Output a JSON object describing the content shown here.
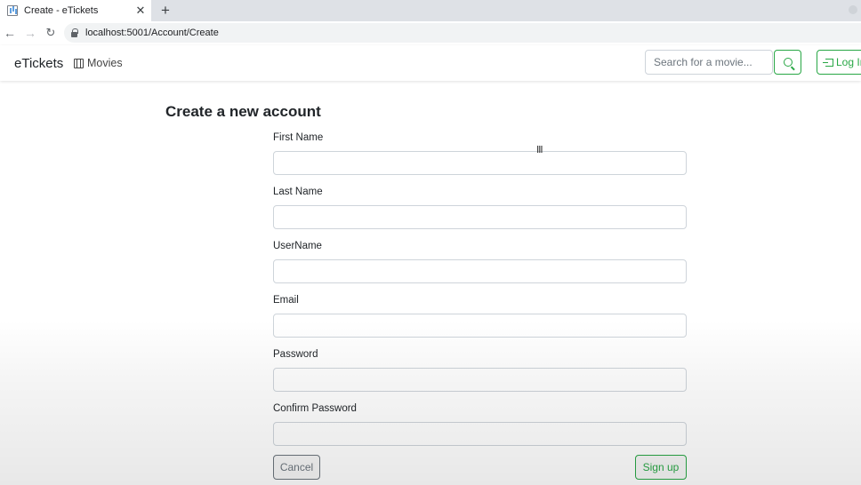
{
  "browser": {
    "tab_title": "Create - eTickets",
    "tab_close": "✕",
    "new_tab": "+",
    "url": "localhost:5001/Account/Create"
  },
  "navbar": {
    "brand": "eTickets",
    "movies_label": "Movies",
    "search_placeholder": "Search for a movie...",
    "login_label": "Log In"
  },
  "form": {
    "title": "Create a new account",
    "fields": [
      {
        "label": "First Name",
        "value": ""
      },
      {
        "label": "Last Name",
        "value": ""
      },
      {
        "label": "UserName",
        "value": ""
      },
      {
        "label": "Email",
        "value": ""
      },
      {
        "label": "Password",
        "value": ""
      },
      {
        "label": "Confirm Password",
        "value": ""
      }
    ],
    "cancel_label": "Cancel",
    "signup_label": "Sign up"
  },
  "colors": {
    "accent_success": "#28a745",
    "secondary": "#6c757d"
  }
}
